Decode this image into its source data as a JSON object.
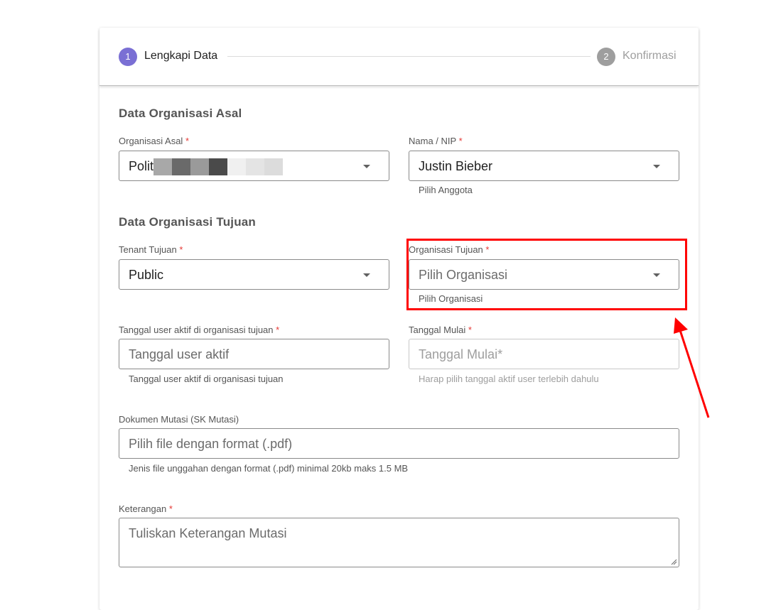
{
  "stepper": {
    "steps": [
      {
        "number": "1",
        "label": "Lengkapi Data"
      },
      {
        "number": "2",
        "label": "Konfirmasi"
      }
    ]
  },
  "sections": {
    "asal_title": "Data Organisasi Asal",
    "tujuan_title": "Data Organisasi Tujuan"
  },
  "fields": {
    "organisasi_asal": {
      "label": "Organisasi Asal",
      "required": "*",
      "value": "Polit"
    },
    "nama_nip": {
      "label": "Nama / NIP",
      "required": "*",
      "value": "Justin Bieber",
      "hint": "Pilih Anggota"
    },
    "tenant_tujuan": {
      "label": "Tenant Tujuan",
      "required": "*",
      "value": "Public"
    },
    "organisasi_tujuan": {
      "label": "Organisasi Tujuan",
      "required": "*",
      "placeholder": "Pilih Organisasi",
      "hint": "Pilih Organisasi"
    },
    "tanggal_user_aktif": {
      "label": "Tanggal user aktif di organisasi tujuan",
      "required": "*",
      "placeholder": "Tanggal user aktif",
      "hint": "Tanggal user aktif di organisasi tujuan"
    },
    "tanggal_mulai": {
      "label": "Tanggal Mulai",
      "required": "*",
      "placeholder": "Tanggal Mulai*",
      "hint": "Harap pilih tanggal aktif user terlebih dahulu"
    },
    "dokumen_mutasi": {
      "label": "Dokumen Mutasi (SK Mutasi)",
      "placeholder": "Pilih file dengan format (.pdf)",
      "hint": "Jenis file unggahan dengan format (.pdf) minimal 20kb maks 1.5 MB"
    },
    "keterangan": {
      "label": "Keterangan",
      "required": "*",
      "placeholder": "Tuliskan Keterangan Mutasi"
    }
  },
  "colors": {
    "accent": "#7a6fd4",
    "annotation": "#ff0000",
    "required": "#e53935"
  }
}
